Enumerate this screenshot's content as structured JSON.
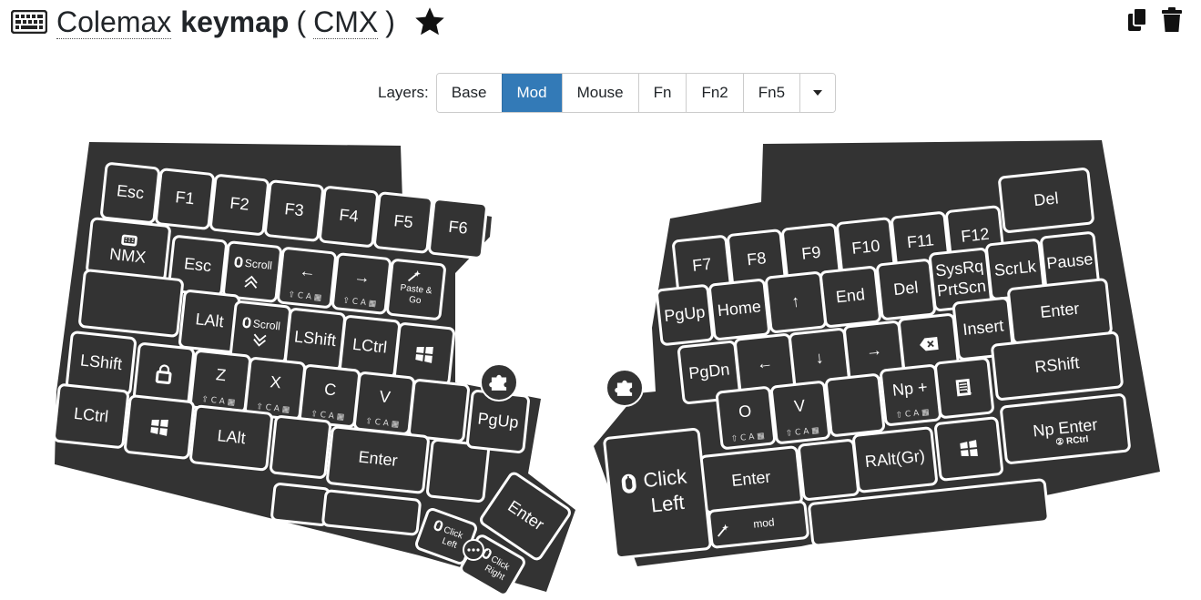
{
  "header": {
    "name": "Colemax",
    "keyword": "keymap",
    "paren_open": "(",
    "short": "CMX",
    "paren_close": ")",
    "icon": "keyboard-icon",
    "star_icon": "star-icon",
    "copy_icon": "copy-icon",
    "delete_icon": "trash-icon"
  },
  "layers": {
    "label": "Layers:",
    "items": [
      "Base",
      "Mod",
      "Mouse",
      "Fn",
      "Fn2",
      "Fn5"
    ],
    "active": "Mod",
    "more_icon": "caret-down-icon"
  },
  "colors": {
    "board": "#333333",
    "key_border": "#ffffff",
    "active_layer": "#337ab7"
  },
  "mods_hint": "⇧ C A ▦",
  "left_keys": [
    {
      "label": "Esc"
    },
    {
      "label": "F1"
    },
    {
      "label": "F2"
    },
    {
      "label": "F3"
    },
    {
      "label": "F4"
    },
    {
      "label": "F5"
    },
    {
      "label": "F6"
    },
    {
      "label": "NMX",
      "icon": "keyboard-icon"
    },
    {
      "label": "Esc"
    },
    {
      "label": "Scroll",
      "icon": "mouse-icon",
      "sub": "up-chevron-icon"
    },
    {
      "label": "←",
      "mods": true
    },
    {
      "label": "→",
      "mods": true
    },
    {
      "label": "Paste & Go",
      "icon": "magic-wand-icon"
    },
    {
      "label": ""
    },
    {
      "label": "LAlt"
    },
    {
      "label": "Scroll",
      "icon": "mouse-icon",
      "sub": "down-chevron-icon"
    },
    {
      "label": "LShift"
    },
    {
      "label": "LCtrl"
    },
    {
      "label": "",
      "icon": "windows-icon"
    },
    {
      "label": "LShift"
    },
    {
      "label": "",
      "icon": "lock-icon"
    },
    {
      "label": "Z",
      "mods": true
    },
    {
      "label": "X",
      "mods": true
    },
    {
      "label": "C",
      "mods": true
    },
    {
      "label": "V",
      "mods": true
    },
    {
      "label": ""
    },
    {
      "label": "LCtrl"
    },
    {
      "label": "",
      "icon": "windows-icon"
    },
    {
      "label": "LAlt"
    },
    {
      "label": ""
    },
    {
      "label": "Enter"
    },
    {
      "label": ""
    },
    {
      "label": ""
    },
    {
      "label": ""
    },
    {
      "label": "PgUp"
    },
    {
      "label": "Enter"
    },
    {
      "label": "Click Left",
      "icon": "mouse-icon"
    },
    {
      "label": "Click Right",
      "icon": "mouse-icon"
    }
  ],
  "right_keys": [
    {
      "label": "F7"
    },
    {
      "label": "F8"
    },
    {
      "label": "F9"
    },
    {
      "label": "F10"
    },
    {
      "label": "F11"
    },
    {
      "label": "F12"
    },
    {
      "label": "Del"
    },
    {
      "label": "PgUp"
    },
    {
      "label": "Home"
    },
    {
      "label": "↑"
    },
    {
      "label": "End"
    },
    {
      "label": "Del"
    },
    {
      "label": "SysRq PrtScn"
    },
    {
      "label": "ScrLk"
    },
    {
      "label": "Pause"
    },
    {
      "label": "PgDn"
    },
    {
      "label": "←"
    },
    {
      "label": "↓"
    },
    {
      "label": "→"
    },
    {
      "label": "",
      "icon": "backspace-icon"
    },
    {
      "label": "Insert"
    },
    {
      "label": "Enter"
    },
    {
      "label": "O",
      "mods": true
    },
    {
      "label": "V",
      "mods": true
    },
    {
      "label": ""
    },
    {
      "label": "Np +",
      "mods": true
    },
    {
      "label": "",
      "icon": "context-menu-icon"
    },
    {
      "label": "RShift"
    },
    {
      "label": "Enter"
    },
    {
      "label": ""
    },
    {
      "label": "RAlt(Gr)"
    },
    {
      "label": "",
      "icon": "windows-icon"
    },
    {
      "label": "Np Enter",
      "sub": "② RCtrl"
    },
    {
      "label": "Click Left",
      "icon": "mouse-icon"
    },
    {
      "label": "mod",
      "icon": "magic-wand-icon"
    },
    {
      "label": ""
    }
  ],
  "badges": {
    "left_puzzle": "puzzle-icon",
    "right_puzzle": "puzzle-icon",
    "ellipsis": "ellipsis-icon"
  }
}
